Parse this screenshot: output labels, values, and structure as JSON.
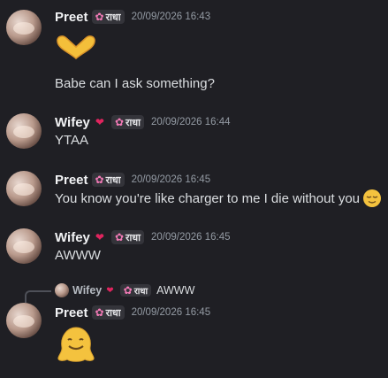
{
  "messages": [
    {
      "author": "Preet",
      "tag": "राधा",
      "timestamp": "20/09/2026 16:43",
      "emoji": "heart-hands-emoji",
      "text": "Babe can I ask something?"
    },
    {
      "author": "Wifey",
      "badge_icon": "mending-heart-icon",
      "tag": "राधा",
      "timestamp": "20/09/2026 16:44",
      "text": "YTAA"
    },
    {
      "author": "Preet",
      "tag": "राधा",
      "timestamp": "20/09/2026 16:45",
      "text": "You know you're like charger to me I die without you",
      "emoji": "relieved-face-emoji"
    },
    {
      "author": "Wifey",
      "badge_icon": "mending-heart-icon",
      "tag": "राधा",
      "timestamp": "20/09/2026 16:45",
      "text": "AWWW"
    },
    {
      "reply_to": {
        "author": "Wifey",
        "badge_icon": "mending-heart-icon",
        "tag": "राधा",
        "text": "AWWW"
      },
      "author": "Preet",
      "tag": "राधा",
      "timestamp": "20/09/2026 16:45",
      "emoji": "melting-face-emoji"
    }
  ],
  "colors": {
    "background": "#1f1f24",
    "name": "#f2f3f5",
    "timestamp": "#949ba4",
    "tag_bg": "#34343a",
    "flower": "#f27ab6",
    "heart": "#e0245e"
  }
}
